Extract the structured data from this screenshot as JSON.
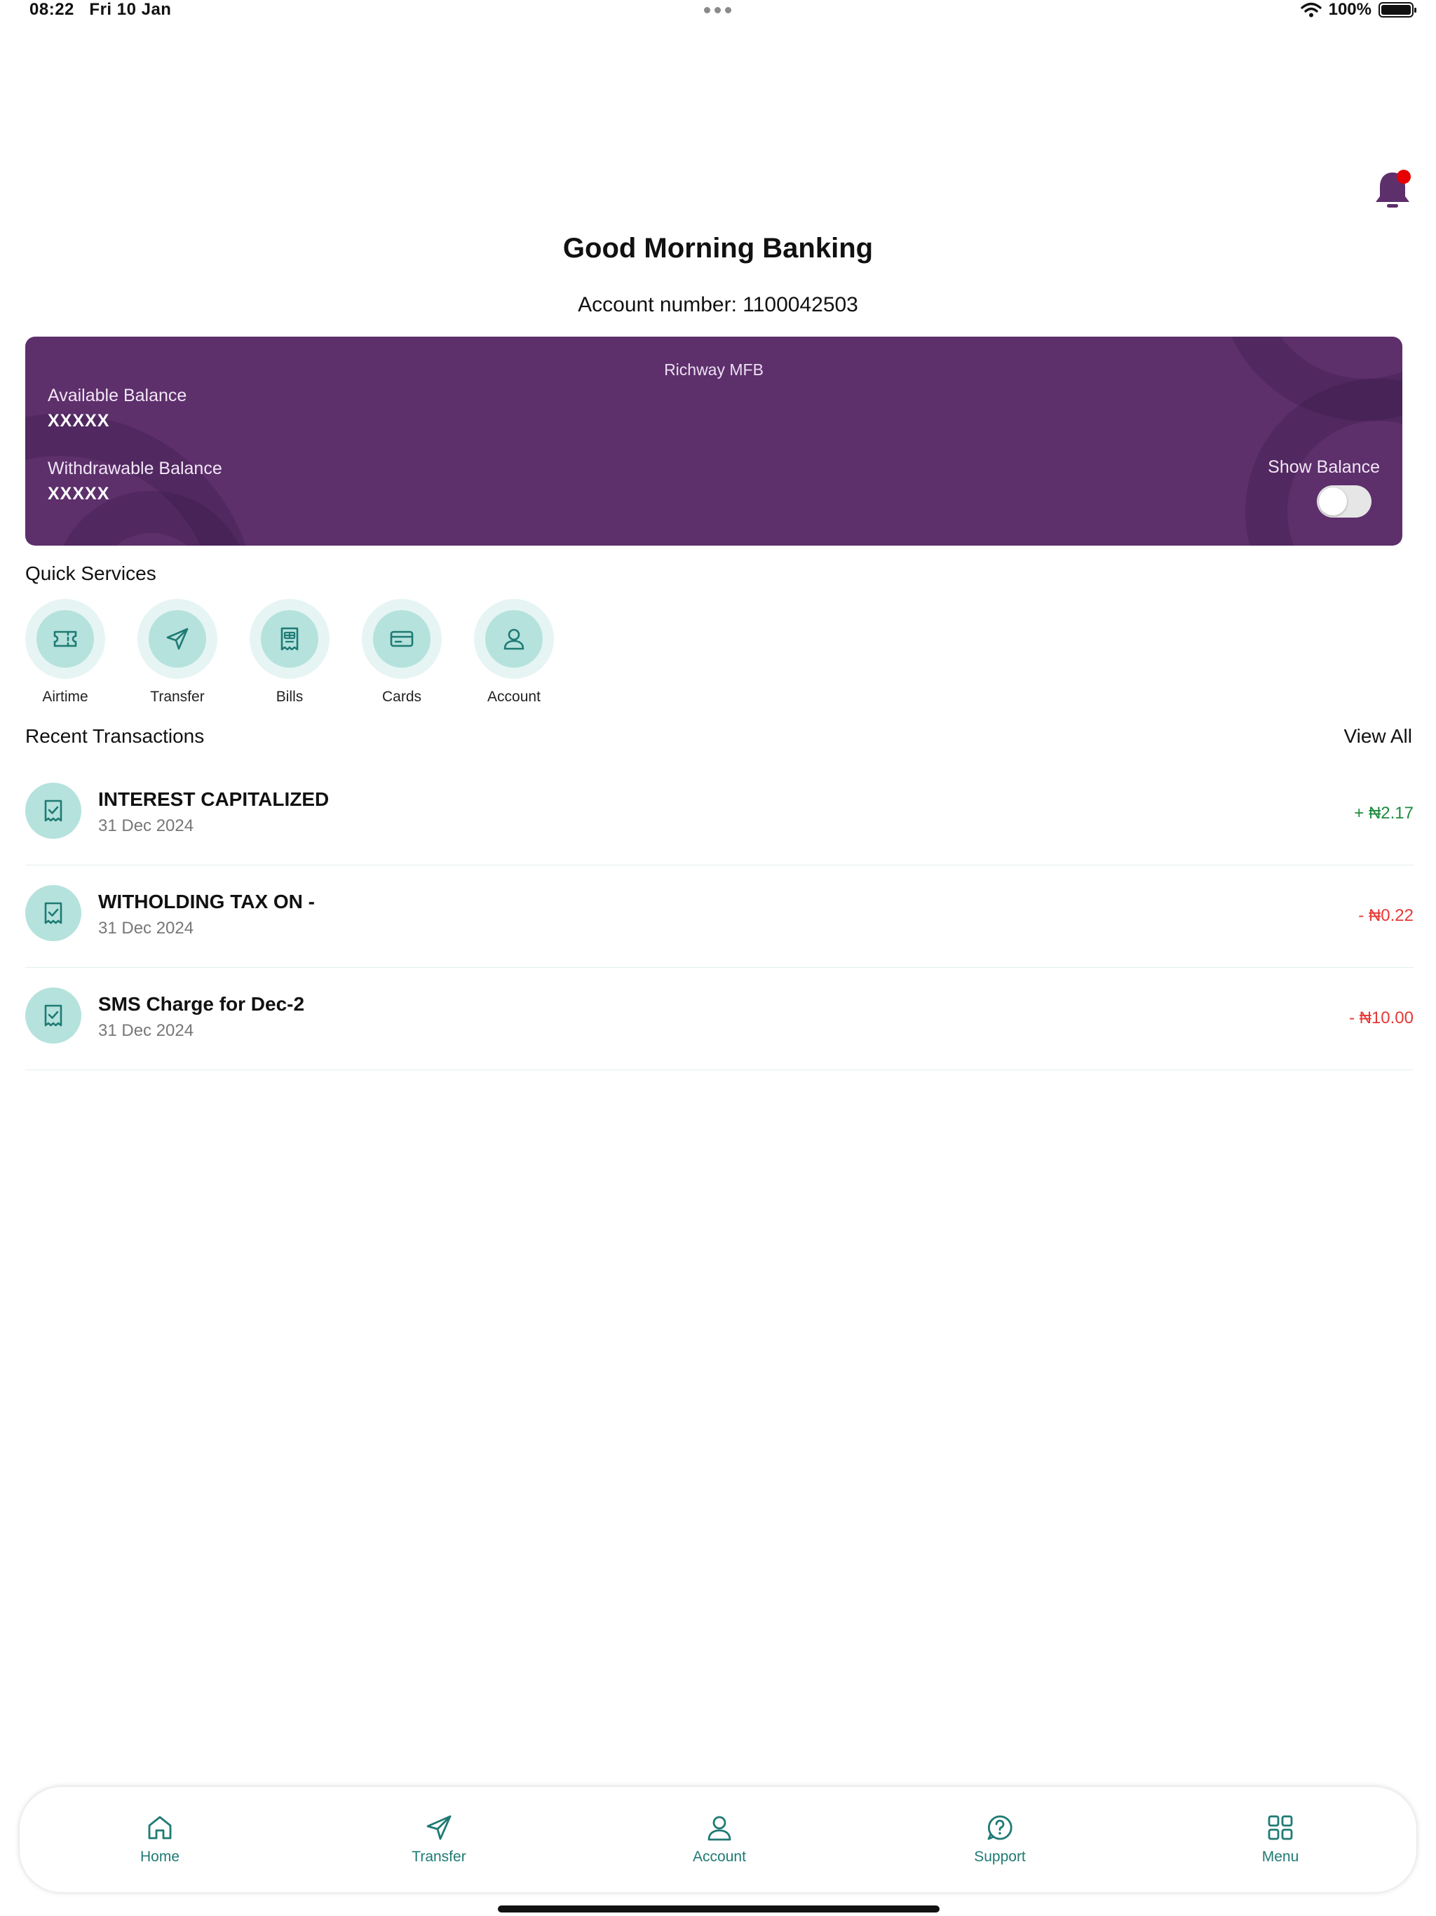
{
  "status_bar": {
    "time": "08:22",
    "date": "Fri 10 Jan",
    "battery": "100%"
  },
  "header": {
    "greeting": "Good Morning Banking",
    "account_number": "Account number: 1100042503"
  },
  "balance_card": {
    "bank_name": "Richway MFB",
    "available_label": "Available Balance",
    "available_value": "XXXXX",
    "withdrawable_label": "Withdrawable Balance",
    "withdrawable_value": "XXXXX",
    "show_balance_label": "Show Balance",
    "show_balance_on": false
  },
  "quick_services": {
    "title": "Quick Services",
    "items": [
      {
        "label": "Airtime",
        "icon": "ticket-icon"
      },
      {
        "label": "Transfer",
        "icon": "send-icon"
      },
      {
        "label": "Bills",
        "icon": "receipt-icon"
      },
      {
        "label": "Cards",
        "icon": "card-icon"
      },
      {
        "label": "Account",
        "icon": "user-icon"
      }
    ]
  },
  "recent_transactions": {
    "title": "Recent Transactions",
    "view_all": "View All",
    "items": [
      {
        "name": "INTEREST CAPITALIZED",
        "date": "31 Dec 2024",
        "amount": "+ ₦2.17",
        "type": "credit"
      },
      {
        "name": "WITHOLDING TAX ON -",
        "date": "31 Dec 2024",
        "amount": "- ₦0.22",
        "type": "debit"
      },
      {
        "name": "SMS Charge for Dec-2",
        "date": "31 Dec 2024",
        "amount": "- ₦10.00",
        "type": "debit"
      }
    ]
  },
  "bottom_nav": {
    "items": [
      {
        "label": "Home",
        "icon": "home-icon"
      },
      {
        "label": "Transfer",
        "icon": "send-icon"
      },
      {
        "label": "Account",
        "icon": "user-icon"
      },
      {
        "label": "Support",
        "icon": "help-icon"
      },
      {
        "label": "Menu",
        "icon": "grid-icon"
      }
    ]
  },
  "colors": {
    "brand_purple": "#5d2f6b",
    "teal": "#1f7a74",
    "teal_light": "#b5e2dd",
    "credit": "#1e8c3f",
    "debit": "#e53935",
    "notification": "#e60000"
  }
}
